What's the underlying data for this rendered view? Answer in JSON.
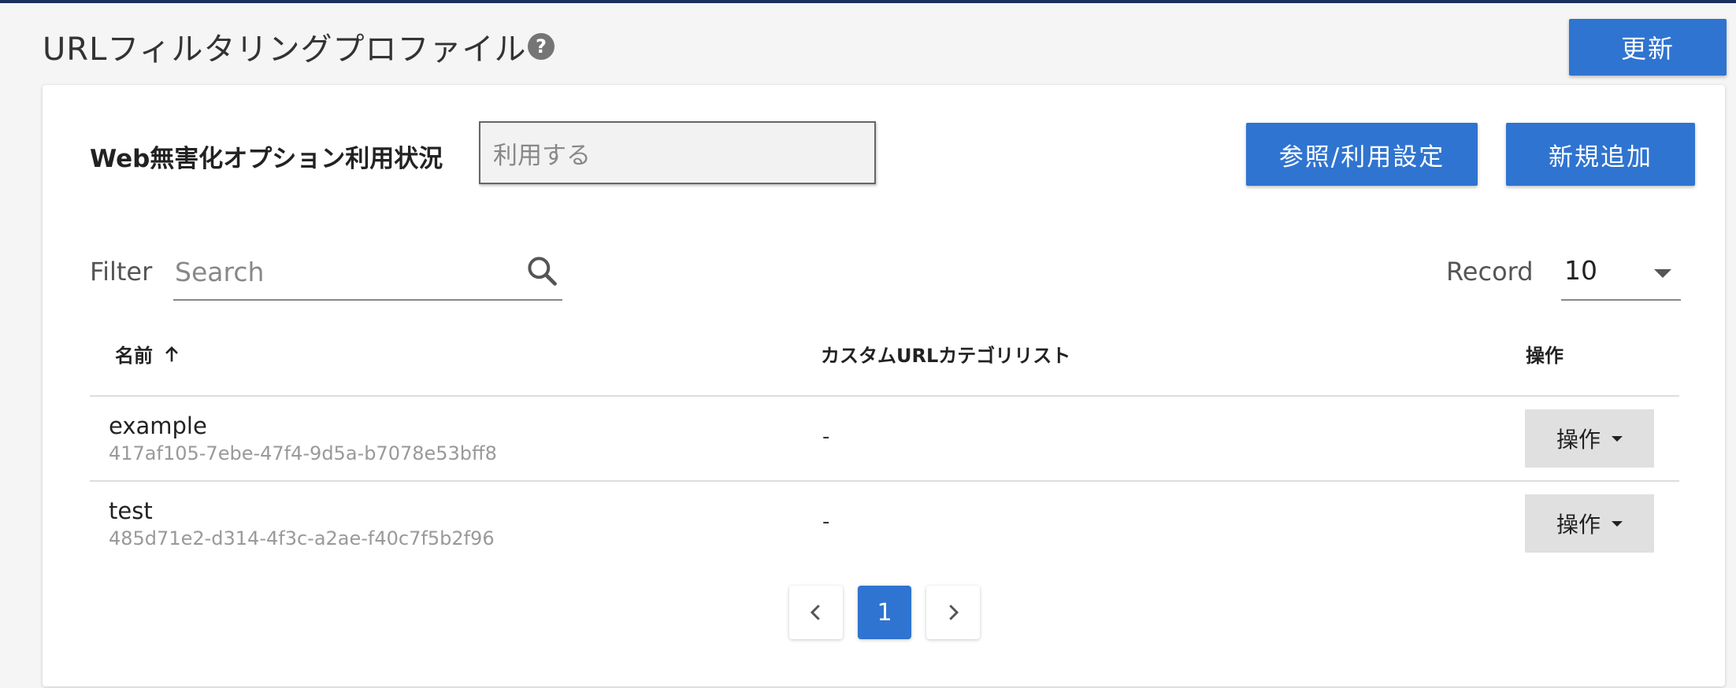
{
  "header": {
    "title": "URLフィルタリングプロファイル",
    "help_icon": "?",
    "refresh_label": "更新"
  },
  "options": {
    "label": "Web無害化オプション利用状況",
    "status_value": "利用する",
    "reference_button": "参照/利用設定",
    "add_button": "新規追加"
  },
  "filter": {
    "label": "Filter",
    "placeholder": "Search"
  },
  "record": {
    "label": "Record",
    "value": "10"
  },
  "table": {
    "columns": [
      "名前",
      "カスタムURLカテゴリリスト",
      "操作"
    ],
    "sort": "ascending",
    "rows": [
      {
        "name": "example",
        "id": "417af105-7ebe-47f4-9d5a-b7078e53bff8",
        "category": "-",
        "action": "操作"
      },
      {
        "name": "test",
        "id": "485d71e2-d314-4f3c-a2ae-f40c7f5b2f96",
        "category": "-",
        "action": "操作"
      }
    ]
  },
  "pagination": {
    "current_page": "1"
  },
  "colors": {
    "primary": "#2f74d0",
    "top_rule": "#1b2e5c"
  }
}
